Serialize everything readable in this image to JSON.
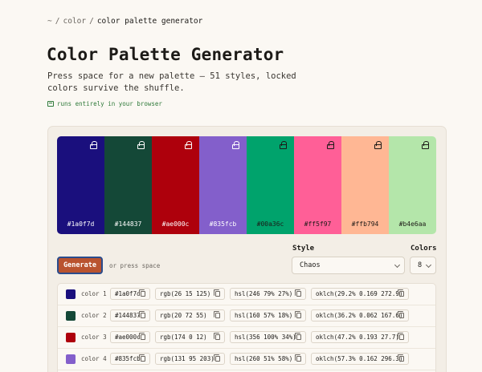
{
  "breadcrumb": {
    "home": "~",
    "sep1": "/",
    "section": "color",
    "sep2": "/",
    "current": "color palette generator"
  },
  "page": {
    "title": "Color Palette Generator",
    "subtitle": "Press space for a new palette — 51 styles, locked colors survive the shuffle.",
    "badge": "runs entirely in your browser"
  },
  "palette": [
    {
      "hex": "#1a0f7d",
      "text_color": "#ffffff"
    },
    {
      "hex": "#144837",
      "text_color": "#ffffff"
    },
    {
      "hex": "#ae000c",
      "text_color": "#ffffff"
    },
    {
      "hex": "#835fcb",
      "text_color": "#ffffff"
    },
    {
      "hex": "#00a36c",
      "text_color": "#1c1a17"
    },
    {
      "hex": "#ff5f97",
      "text_color": "#1c1a17"
    },
    {
      "hex": "#ffb794",
      "text_color": "#1c1a17"
    },
    {
      "hex": "#b4e6aa",
      "text_color": "#1c1a17"
    }
  ],
  "controls": {
    "generate_label": "Generate",
    "or_press": "or press space",
    "style_label": "Style",
    "style_value": "Chaos",
    "colors_label": "Colors",
    "colors_value": "8"
  },
  "colors_table": [
    {
      "name": "color 1",
      "swatch": "#1a0f7d",
      "hex": "#1a0f7d",
      "rgb": "rgb(26 15 125)",
      "hsl": "hsl(246 79% 27%)",
      "oklch": "oklch(29.2% 0.169 272.9)"
    },
    {
      "name": "color 2",
      "swatch": "#144837",
      "hex": "#144837",
      "rgb": "rgb(20 72 55)",
      "hsl": "hsl(160 57% 18%)",
      "oklch": "oklch(36.2% 0.062 167.6)"
    },
    {
      "name": "color 3",
      "swatch": "#ae000c",
      "hex": "#ae000c",
      "rgb": "rgb(174 0 12)",
      "hsl": "hsl(356 100% 34%)",
      "oklch": "oklch(47.2% 0.193 27.7)"
    },
    {
      "name": "color 4",
      "swatch": "#835fcb",
      "hex": "#835fcb",
      "rgb": "rgb(131 95 203)",
      "hsl": "hsl(260 51% 58%)",
      "oklch": "oklch(57.3% 0.162 296.3)"
    }
  ]
}
